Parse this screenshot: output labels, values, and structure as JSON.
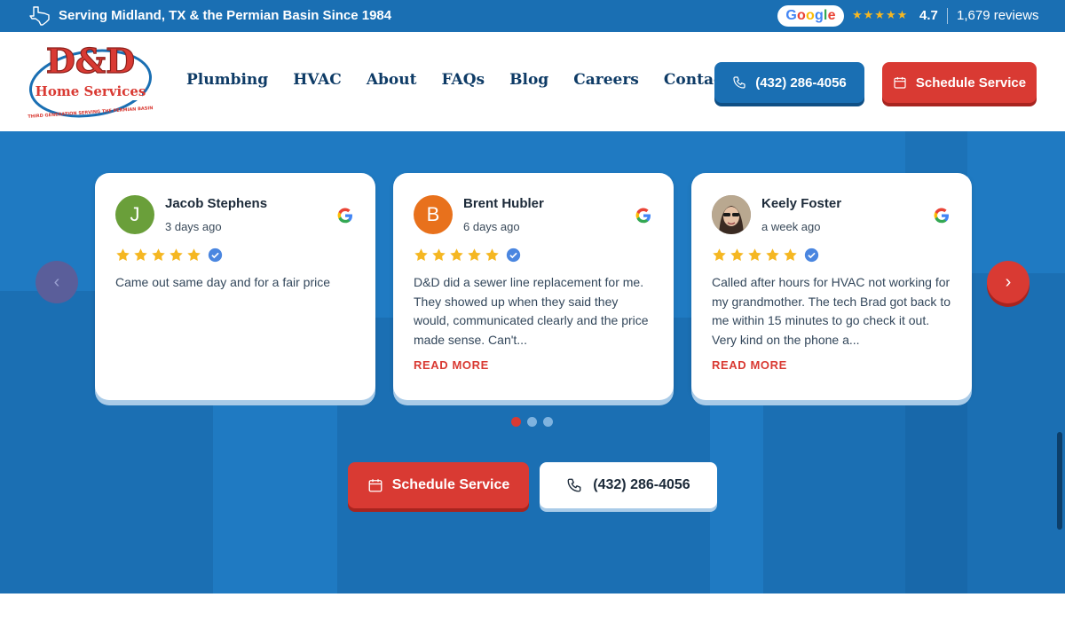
{
  "topbar": {
    "serving": "Serving Midland, TX & the Permian Basin Since 1984",
    "google_letters": [
      "G",
      "o",
      "o",
      "g",
      "l",
      "e"
    ],
    "stars": "★★★★★",
    "rating": "4.7",
    "reviews": "1,679 reviews"
  },
  "logo": {
    "line1": "D&D",
    "line2": "Home Services",
    "tagline": "THIRD GENERATION SERVING THE PERMIAN BASIN"
  },
  "nav": {
    "items": [
      "Plumbing",
      "HVAC",
      "About",
      "FAQs",
      "Blog",
      "Careers",
      "Contact"
    ]
  },
  "header": {
    "phone": "(432) 286-4056",
    "schedule": "Schedule Service"
  },
  "reviews": [
    {
      "initial": "J",
      "avatar_color": "#6a9f3a",
      "name": "Jacob Stephens",
      "date": "3 days ago",
      "rating": 5,
      "text": "Came out same day and for a fair price",
      "read_more": ""
    },
    {
      "initial": "B",
      "avatar_color": "#e8711c",
      "name": "Brent Hubler",
      "date": "6 days ago",
      "rating": 5,
      "text": "D&D did a sewer line replacement for me. They showed up when they said they would, communicated clearly and the price made sense. Can't...",
      "read_more": "READ MORE"
    },
    {
      "initial": "",
      "avatar_color": "#8a7a6a",
      "name": "Keely Foster",
      "date": "a week ago",
      "rating": 5,
      "text": "Called after hours for HVAC not working for my grandmother. The tech Brad got back to me within 15 minutes to go check it out. Very kind on the phone a...",
      "read_more": "READ MORE"
    }
  ],
  "carousel": {
    "prev_icon": "‹",
    "next_icon": "›",
    "dot_count": 3,
    "active_dot": 0
  },
  "hero": {
    "schedule": "Schedule Service",
    "phone": "(432) 286-4056"
  },
  "colors": {
    "brand_blue": "#1a6fb3",
    "brand_red": "#d93a33",
    "navy": "#0e3b66"
  }
}
